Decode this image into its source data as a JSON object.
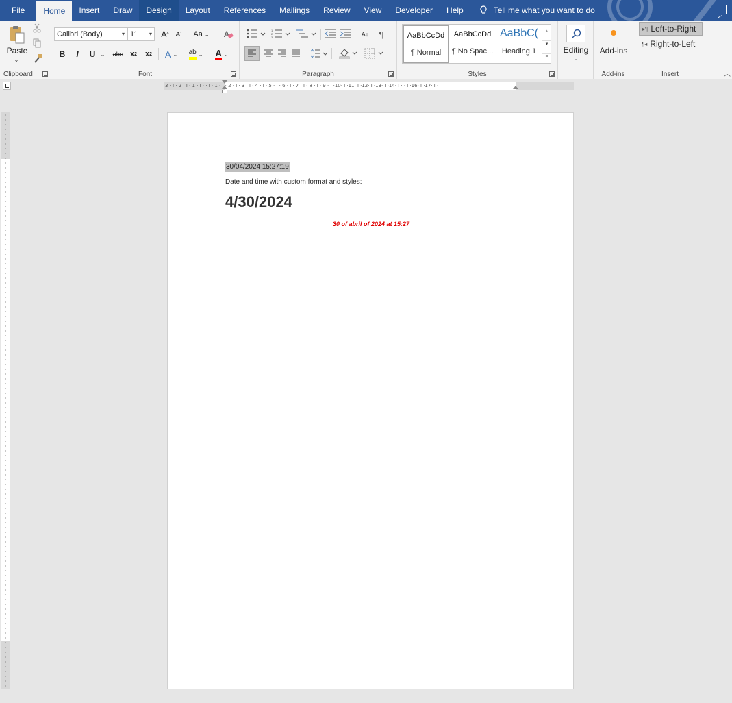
{
  "tabs": {
    "file": "File",
    "home": "Home",
    "insert": "Insert",
    "draw": "Draw",
    "design": "Design",
    "layout": "Layout",
    "references": "References",
    "mailings": "Mailings",
    "review": "Review",
    "view": "View",
    "developer": "Developer",
    "help": "Help",
    "tell_me": "Tell me what you want to do"
  },
  "clipboard": {
    "paste": "Paste",
    "label": "Clipboard"
  },
  "font": {
    "name": "Calibri (Body)",
    "size": "11",
    "label": "Font",
    "grow": "A",
    "shrink": "A",
    "case": "Aa",
    "bold": "B",
    "italic": "I",
    "underline": "U",
    "strike": "abc",
    "sub": "x",
    "sup": "x",
    "effects": "A",
    "highlight": "ab",
    "color": "A"
  },
  "paragraph": {
    "label": "Paragraph",
    "sort": "A↓",
    "pilcrow": "¶"
  },
  "styles": {
    "label": "Styles",
    "items": [
      {
        "sample": "AaBbCcDd",
        "name": "¶ Normal"
      },
      {
        "sample": "AaBbCcDd",
        "name": "¶ No Spac..."
      },
      {
        "sample": "AaBbC(",
        "name": "Heading 1"
      }
    ]
  },
  "editing": {
    "label": "Editing"
  },
  "addins": {
    "button": "Add-ins",
    "label": "Add-ins"
  },
  "insert_group": {
    "ltr": "Left-to-Right",
    "rtl": "Right-to-Left",
    "label": "Insert"
  },
  "document": {
    "line1": "30/04/2024 15:27:19",
    "line2": "Date and time with custom format and styles:",
    "line3": "4/30/2024",
    "line4": "30 of abril of 2024 at 15:27"
  },
  "ruler": {
    "horizontal": "3 · ı · 2 · ı · 1 · ı ·   · ı · 1 · ı · 2 · ı · 3 · ı · 4 · ı · 5 · ı · 6 · ı · 7 · ı · 8 · ı · 9 · ı ·10· ı ·11· ı ·12· ı ·13· ı ·14· ı ·   · ı ·16· ı ·17· ı ·"
  },
  "colors": {
    "ribbon_blue": "#2b579a",
    "doc_red": "#e00000"
  }
}
